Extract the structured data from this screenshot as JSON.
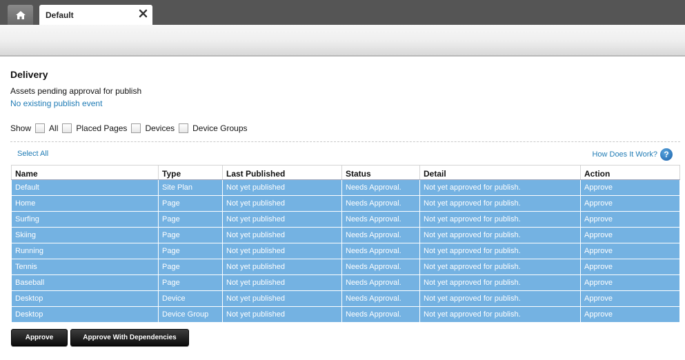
{
  "tabs": {
    "home_icon": "home-icon",
    "active_tab_label": "Default",
    "close_icon": "close-icon"
  },
  "page": {
    "title": "Delivery",
    "subtitle": "Assets pending approval for publish",
    "event_link": "No existing publish event"
  },
  "filters": {
    "show_label": "Show",
    "options": [
      "All",
      "Placed Pages",
      "Devices",
      "Device Groups"
    ]
  },
  "actions": {
    "select_all": "Select All",
    "how_it_works": "How Does It Work?",
    "help_icon": "help-icon"
  },
  "table": {
    "headers": [
      "Name",
      "Type",
      "Last Published",
      "Status",
      "Detail",
      "Action"
    ],
    "rows": [
      [
        "Default",
        "Site Plan",
        "Not yet published",
        "Needs Approval.",
        "Not yet approved for publish.",
        "Approve"
      ],
      [
        "Home",
        "Page",
        "Not yet published",
        "Needs Approval.",
        "Not yet approved for publish.",
        "Approve"
      ],
      [
        "Surfing",
        "Page",
        "Not yet published",
        "Needs Approval.",
        "Not yet approved for publish.",
        "Approve"
      ],
      [
        "Skiing",
        "Page",
        "Not yet published",
        "Needs Approval.",
        "Not yet approved for publish.",
        "Approve"
      ],
      [
        "Running",
        "Page",
        "Not yet published",
        "Needs Approval.",
        "Not yet approved for publish.",
        "Approve"
      ],
      [
        "Tennis",
        "Page",
        "Not yet published",
        "Needs Approval.",
        "Not yet approved for publish.",
        "Approve"
      ],
      [
        "Baseball",
        "Page",
        "Not yet published",
        "Needs Approval.",
        "Not yet approved for publish.",
        "Approve"
      ],
      [
        "Desktop",
        "Device",
        "Not yet published",
        "Needs Approval.",
        "Not yet approved for publish.",
        "Approve"
      ],
      [
        "Desktop",
        "Device Group",
        "Not yet published",
        "Needs Approval.",
        "Not yet approved for publish.",
        "Approve"
      ]
    ]
  },
  "buttons": {
    "approve": "Approve",
    "approve_with_dependencies": "Approve With Dependencies"
  },
  "colors": {
    "row_selected": "#74b2e2",
    "link": "#1f7bb5",
    "tabbar": "#555555"
  }
}
